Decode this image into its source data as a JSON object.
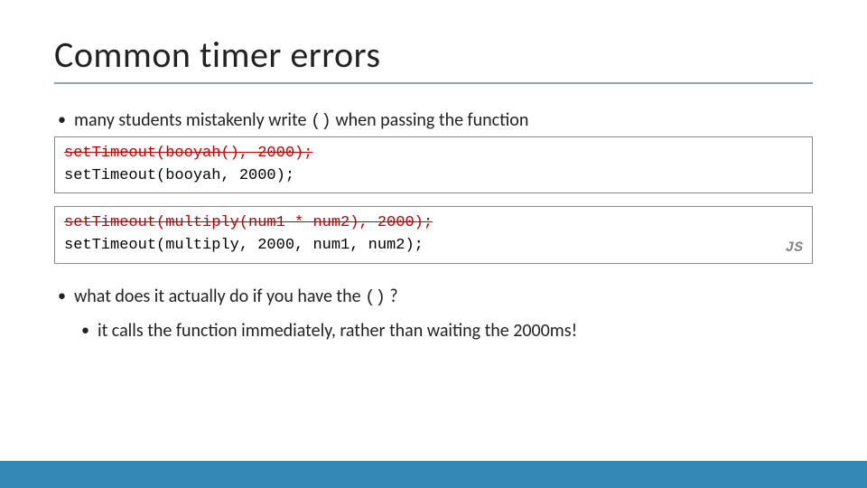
{
  "title": "Common timer errors",
  "bullet1_a": "many students mistakenly write ",
  "bullet1_code": "()",
  "bullet1_b": " when passing the function",
  "code1_wrong": "setTimeout(booyah(), 2000);",
  "code1_right": "setTimeout(booyah, 2000);",
  "code2_wrong": "setTimeout(multiply(num1 * num2), 2000);",
  "code2_right": "setTimeout(multiply, 2000, num1, num2);",
  "badge": "JS",
  "bullet2_a": "what does it actually do if you have the ",
  "bullet2_code": "()",
  "bullet2_b": " ?",
  "bullet3": "it calls the function immediately, rather than waiting the 2000ms!"
}
